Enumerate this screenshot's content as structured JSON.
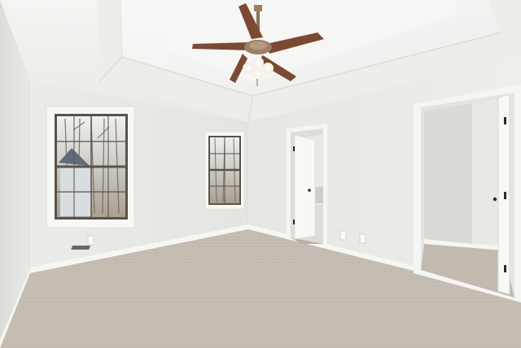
{
  "scene": {
    "kind": "photo",
    "subject": "empty-bedroom",
    "colors": {
      "ceiling": "#f1f1ef",
      "wall_left": "#e6e6e3",
      "wall_back": "#ecece9",
      "wall_right": "#e9e9e6",
      "carpet": "#c7bfb4",
      "trim": "#f7f7f5",
      "fan_blade": "#7a4a32",
      "fan_metal": "#9b7f66",
      "door_hinge": "#2a2a2a"
    },
    "elements": {
      "ceiling_fan": "ceiling-fan-with-light",
      "windows": [
        "left-window",
        "center-window"
      ],
      "doors": [
        "bathroom-doorway",
        "closet-doorway"
      ],
      "floor": "carpet"
    }
  }
}
